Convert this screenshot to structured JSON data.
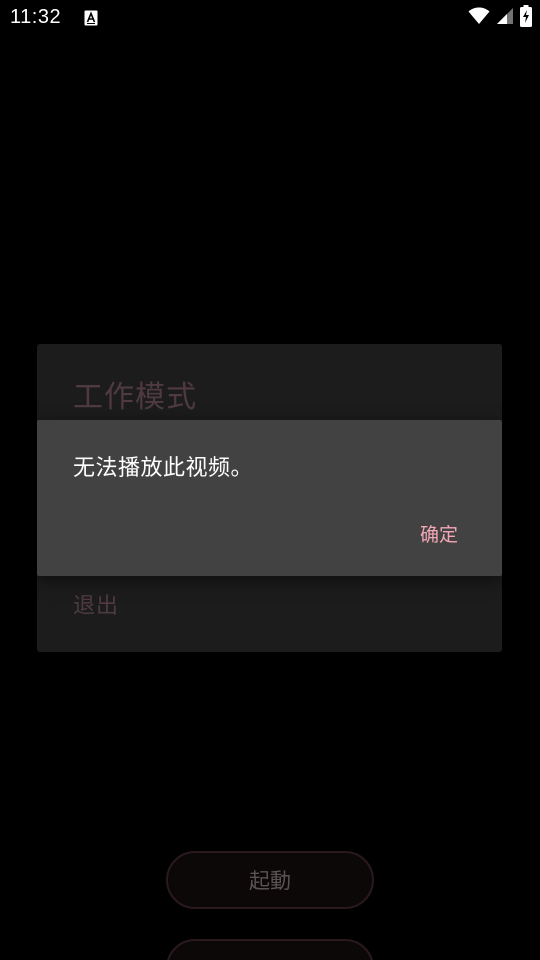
{
  "status_bar": {
    "time": "11:32",
    "notification_icon": "a-accessibility-icon",
    "wifi_icon": "wifi-icon",
    "signal_icon": "cell-signal-icon",
    "battery_icon": "battery-charging-icon"
  },
  "background_dialog": {
    "title": "工作模式",
    "exit_label": "退出"
  },
  "alert": {
    "message": "无法播放此视频。",
    "ok_label": "确定"
  },
  "buttons": {
    "start_label": "起動",
    "second_label": ""
  },
  "colors": {
    "background": "#000000",
    "alert_bg": "#424242",
    "accent": "#f3a7b8",
    "dim_text": "#4f3a41"
  }
}
